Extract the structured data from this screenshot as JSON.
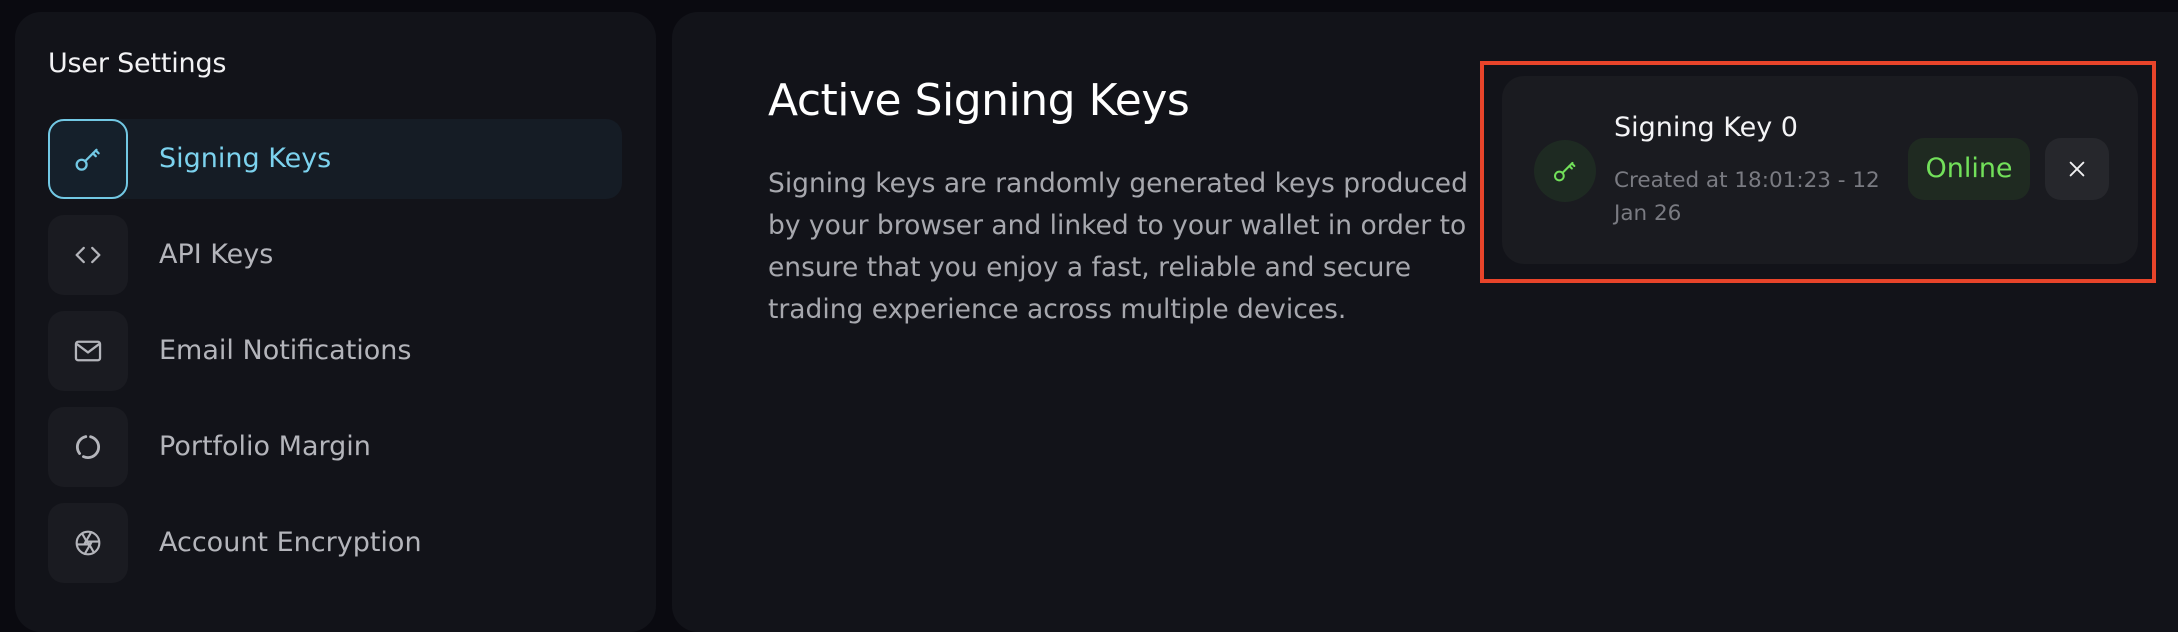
{
  "sidebar": {
    "title": "User Settings",
    "items": [
      {
        "label": "Signing Keys",
        "icon": "key-icon",
        "active": true
      },
      {
        "label": "API Keys",
        "icon": "code-icon",
        "active": false
      },
      {
        "label": "Email Notifications",
        "icon": "mail-icon",
        "active": false
      },
      {
        "label": "Portfolio Margin",
        "icon": "circle-dashed-icon",
        "active": false
      },
      {
        "label": "Account Encryption",
        "icon": "aperture-icon",
        "active": false
      }
    ]
  },
  "main": {
    "title": "Active Signing Keys",
    "description": "Signing keys are randomly generated keys produced by your browser and linked to your wallet in order to ensure that you enjoy a fast, reliable and secure trading experience across multiple devices."
  },
  "signing_key": {
    "name": "Signing Key 0",
    "created": "Created at 18:01:23 - 12 Jan 26",
    "status": "Online",
    "icon": "key-icon",
    "close_icon": "close-icon"
  },
  "colors": {
    "accent": "#7cd2ee",
    "online": "#72e05a",
    "highlight": "#e8442a",
    "panel": "#121319"
  }
}
